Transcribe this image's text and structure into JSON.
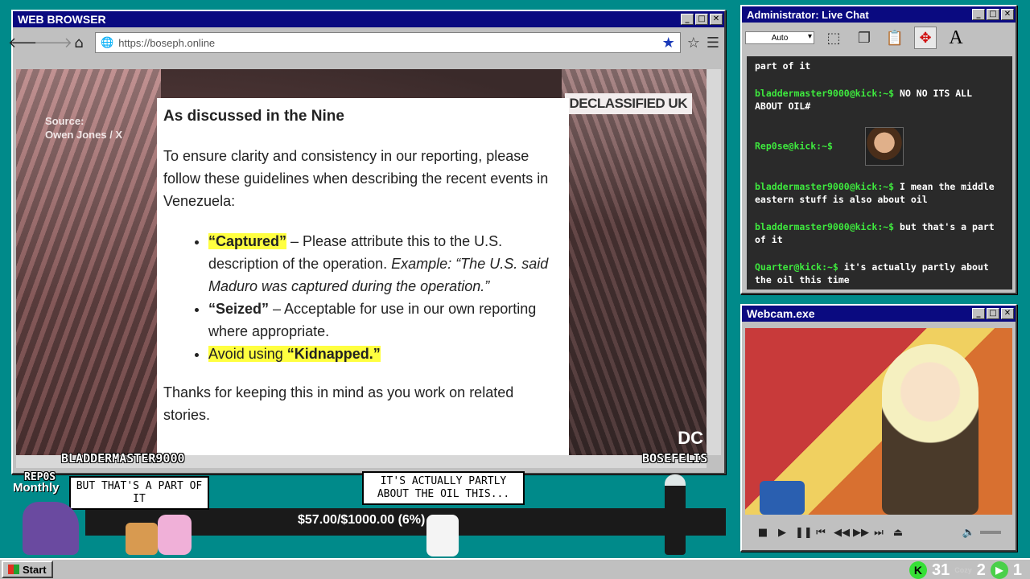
{
  "browser": {
    "title": "WEB BROWSER",
    "url": "https://boseph.online",
    "page": {
      "source_line1": "Source:",
      "source_line2": "Owen Jones / X",
      "doc_title": "As discussed in the Nine",
      "intro": "To ensure clarity and consistency in our reporting, please follow these guidelines when describing the recent events in Venezuela:",
      "bullet1_term": "“Captured”",
      "bullet1_text": " – Please attribute this to the U.S. description of the operation. ",
      "bullet1_example": "Example: “The U.S. said Maduro was captured during the operation.”",
      "bullet2_term": "“Seized”",
      "bullet2_text": " – Acceptable for use in our own reporting where appropriate.",
      "bullet3_text": "Avoid using ",
      "bullet3_term": "“Kidnapped.”",
      "outro": "Thanks for keeping this in mind as you work on related stories.",
      "declassified": "DECLASSIFIED UK",
      "dc_logo": "DC"
    }
  },
  "nameplates": {
    "left": "BLADDERMASTER9000",
    "right": "BOSEFELIS",
    "rep": "REP0S"
  },
  "chat": {
    "title": "Administrator: Live Chat",
    "font_select": "Auto",
    "messages": [
      {
        "user": "",
        "text": "part of it"
      },
      {
        "user": "bladdermaster9000@kick:~$",
        "text": " NO NO ITS ALL ABOUT OIL#"
      },
      {
        "user": "Rep0se@kick:~$",
        "text": ""
      },
      {
        "user": "bladdermaster9000@kick:~$",
        "text": " I mean the middle eastern stuff is also about oil"
      },
      {
        "user": "bladdermaster9000@kick:~$",
        "text": " but that's a part of it"
      },
      {
        "user": "Quarter@kick:~$",
        "text": " it's actually partly about the oil this time"
      }
    ]
  },
  "webcam": {
    "title": "Webcam.exe"
  },
  "overlay": {
    "monthly": "Monthly",
    "bubble_left": "BUT THAT'S A PART OF IT",
    "bubble_center": "IT'S ACTUALLY PARTLY ABOUT THE OIL THIS...",
    "donation": "$57.00/$1000.00 (6%)",
    "donation_progress": 0.057
  },
  "taskbar": {
    "start": "Start",
    "count1": "31",
    "count2": "2",
    "count3": "1",
    "tray_label": "Cozy"
  },
  "colors": {
    "desktop": "#008a8a",
    "titlebar": "#0a0a80",
    "chat_user": "#3ee83e",
    "highlight": "#ffff40"
  }
}
